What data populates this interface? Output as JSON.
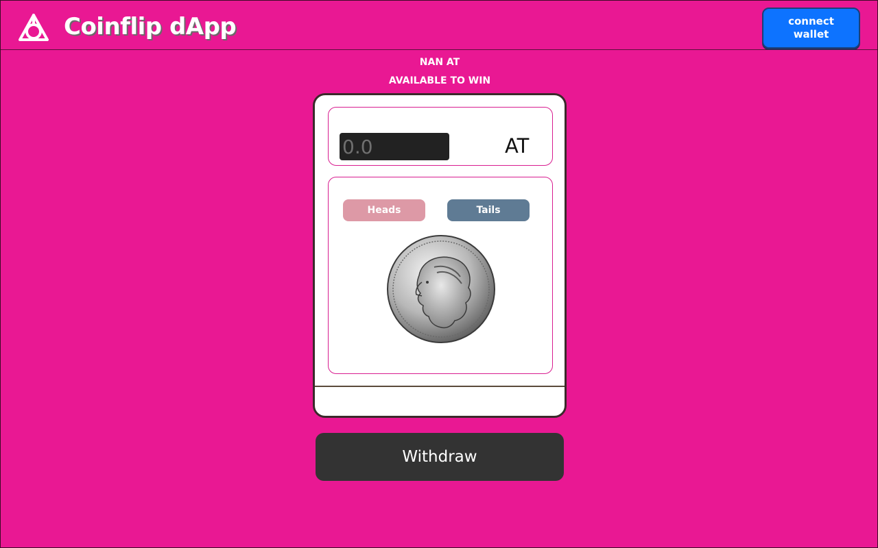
{
  "header": {
    "title": "Coinflip dApp",
    "logo_icon": "triangle-knot-logo-icon",
    "connect_label": "connect wallet"
  },
  "stats": {
    "amount": "NAN AT",
    "caption": "AVAILABLE TO WIN"
  },
  "bet": {
    "amount_placeholder": "0.0",
    "amount_value": "",
    "currency": "AT"
  },
  "sides": {
    "heads_label": "Heads",
    "tails_label": "Tails",
    "heads_color": "#dd99a6",
    "tails_color": "#5f7b94",
    "coin_image": "quarter-coin-icon"
  },
  "actions": {
    "withdraw_label": "Withdraw"
  },
  "colors": {
    "background": "#e91893",
    "connect_button": "#0d73ff",
    "withdraw_button": "#333333"
  }
}
